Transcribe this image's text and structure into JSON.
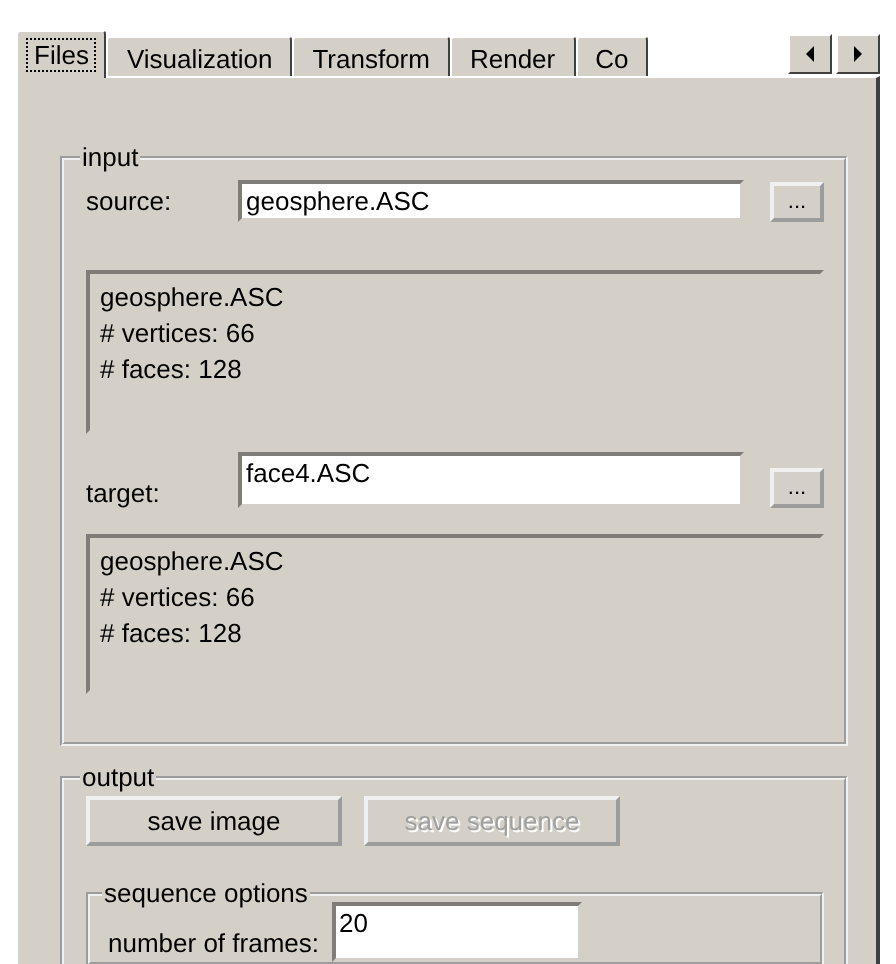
{
  "tabs": [
    {
      "label": "Files",
      "selected": true
    },
    {
      "label": "Visualization",
      "selected": false
    },
    {
      "label": "Transform",
      "selected": false
    },
    {
      "label": "Render",
      "selected": false
    },
    {
      "label": "Co",
      "selected": false
    }
  ],
  "input": {
    "title": "input",
    "source": {
      "label": "source:",
      "value": "geosphere.ASC",
      "browse": "..."
    },
    "source_info": [
      "geosphere.ASC",
      "# vertices: 66",
      "# faces: 128"
    ],
    "target": {
      "label": "target:",
      "value": "face4.ASC",
      "browse": "..."
    },
    "target_info": [
      "geosphere.ASC",
      "# vertices: 66",
      "# faces: 128"
    ]
  },
  "output": {
    "title": "output",
    "buttons": [
      {
        "label": "save image",
        "disabled": false
      },
      {
        "label": "save sequence",
        "disabled": true
      }
    ],
    "sequence_options": {
      "title": "sequence options",
      "frames": {
        "label": "number of frames:",
        "value": "20"
      }
    }
  }
}
